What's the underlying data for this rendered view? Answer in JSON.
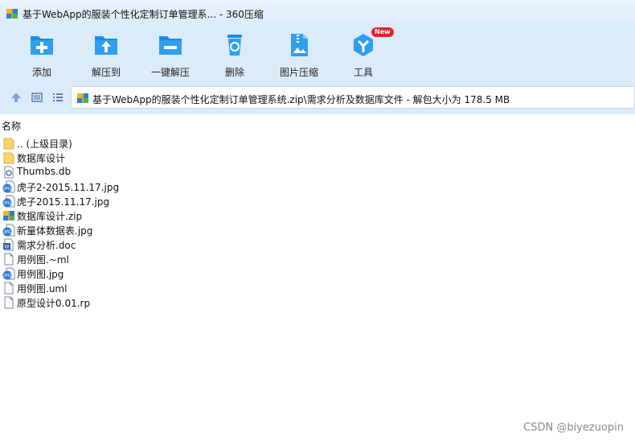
{
  "window": {
    "title": "基于WebApp的服装个性化定制订单管理系... - 360压缩"
  },
  "toolbar": {
    "buttons": [
      {
        "label": "添加",
        "icon": "add-file-icon"
      },
      {
        "label": "解压到",
        "icon": "extract-to-icon"
      },
      {
        "label": "一键解压",
        "icon": "one-click-extract-icon"
      },
      {
        "label": "删除",
        "icon": "delete-icon"
      },
      {
        "label": "图片压缩",
        "icon": "image-compress-icon"
      },
      {
        "label": "工具",
        "icon": "tools-icon",
        "badge": "New"
      }
    ]
  },
  "address": {
    "path": "基于WebApp的服装个性化定制订单管理系统.zip\\需求分析及数据库文件 - 解包大小为 178.5 MB"
  },
  "columns": {
    "name": "名称"
  },
  "files": [
    {
      "name": ".. (上级目录)",
      "icon": "parent-folder-icon"
    },
    {
      "name": "数据库设计",
      "icon": "folder-icon"
    },
    {
      "name": "Thumbs.db",
      "icon": "db-file-icon"
    },
    {
      "name": "虎子2-2015.11.17.jpg",
      "icon": "jpg-file-icon"
    },
    {
      "name": "虎子2015.11.17.jpg",
      "icon": "jpg-file-icon"
    },
    {
      "name": "数据库设计.zip",
      "icon": "zip-file-icon"
    },
    {
      "name": "新量体数据表.jpg",
      "icon": "jpg-file-icon"
    },
    {
      "name": "需求分析.doc",
      "icon": "doc-file-icon"
    },
    {
      "name": "用例图.~ml",
      "icon": "blank-file-icon"
    },
    {
      "name": "用例图.jpg",
      "icon": "jpg-file-icon"
    },
    {
      "name": "用例图.uml",
      "icon": "blank-file-icon"
    },
    {
      "name": "原型设计0.01.rp",
      "icon": "blank-file-icon"
    }
  ],
  "watermark": "CSDN @biyezuopin",
  "colors": {
    "toolbar_bg": "#dcebfa",
    "icon_blue": "#1a8fe0",
    "badge_red": "#e8212f",
    "folder_yellow": "#f7d56b"
  }
}
